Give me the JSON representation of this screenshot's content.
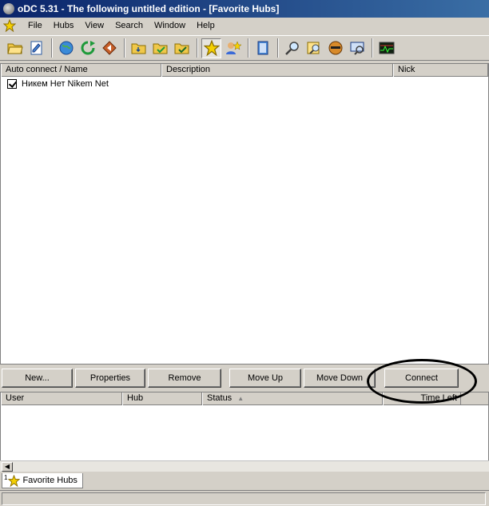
{
  "window": {
    "title": "oDC 5.31 - The following untitled edition - [Favorite Hubs]"
  },
  "menu": {
    "items": [
      "File",
      "Hubs",
      "View",
      "Search",
      "Window",
      "Help"
    ]
  },
  "toolbar": {
    "icons": [
      "open-file-list-icon",
      "open-own-list-icon",
      "public-hubs-icon",
      "reconnect-icon",
      "follow-redirect-icon",
      "download-queue-icon",
      "finished-downloads-icon",
      "finished-uploads-icon",
      "favorite-hubs-icon",
      "favorite-users-icon",
      "notepad-icon",
      "search-icon",
      "adl-search-icon",
      "search-spy-icon",
      "file-list-browser-icon",
      "network-stats-icon"
    ],
    "active": "favorite-hubs-icon"
  },
  "hubs": {
    "columns": [
      "Auto connect / Name",
      "Description",
      "Nick"
    ],
    "rows": [
      {
        "name": "Никем Нет Nikem Net",
        "auto_connect": true
      }
    ]
  },
  "buttons": {
    "new": "New...",
    "properties": "Properties",
    "remove": "Remove",
    "move_up": "Move Up",
    "move_down": "Move Down",
    "connect": "Connect"
  },
  "users": {
    "columns": [
      "User",
      "Hub",
      "Status",
      "Time Left"
    ],
    "sort_indicator": "▲"
  },
  "tabs": [
    {
      "number": "1",
      "label": "Favorite Hubs"
    }
  ],
  "colors": {
    "title_start": "#0a246a",
    "title_end": "#3a6ea5",
    "face": "#d4d0c8"
  }
}
